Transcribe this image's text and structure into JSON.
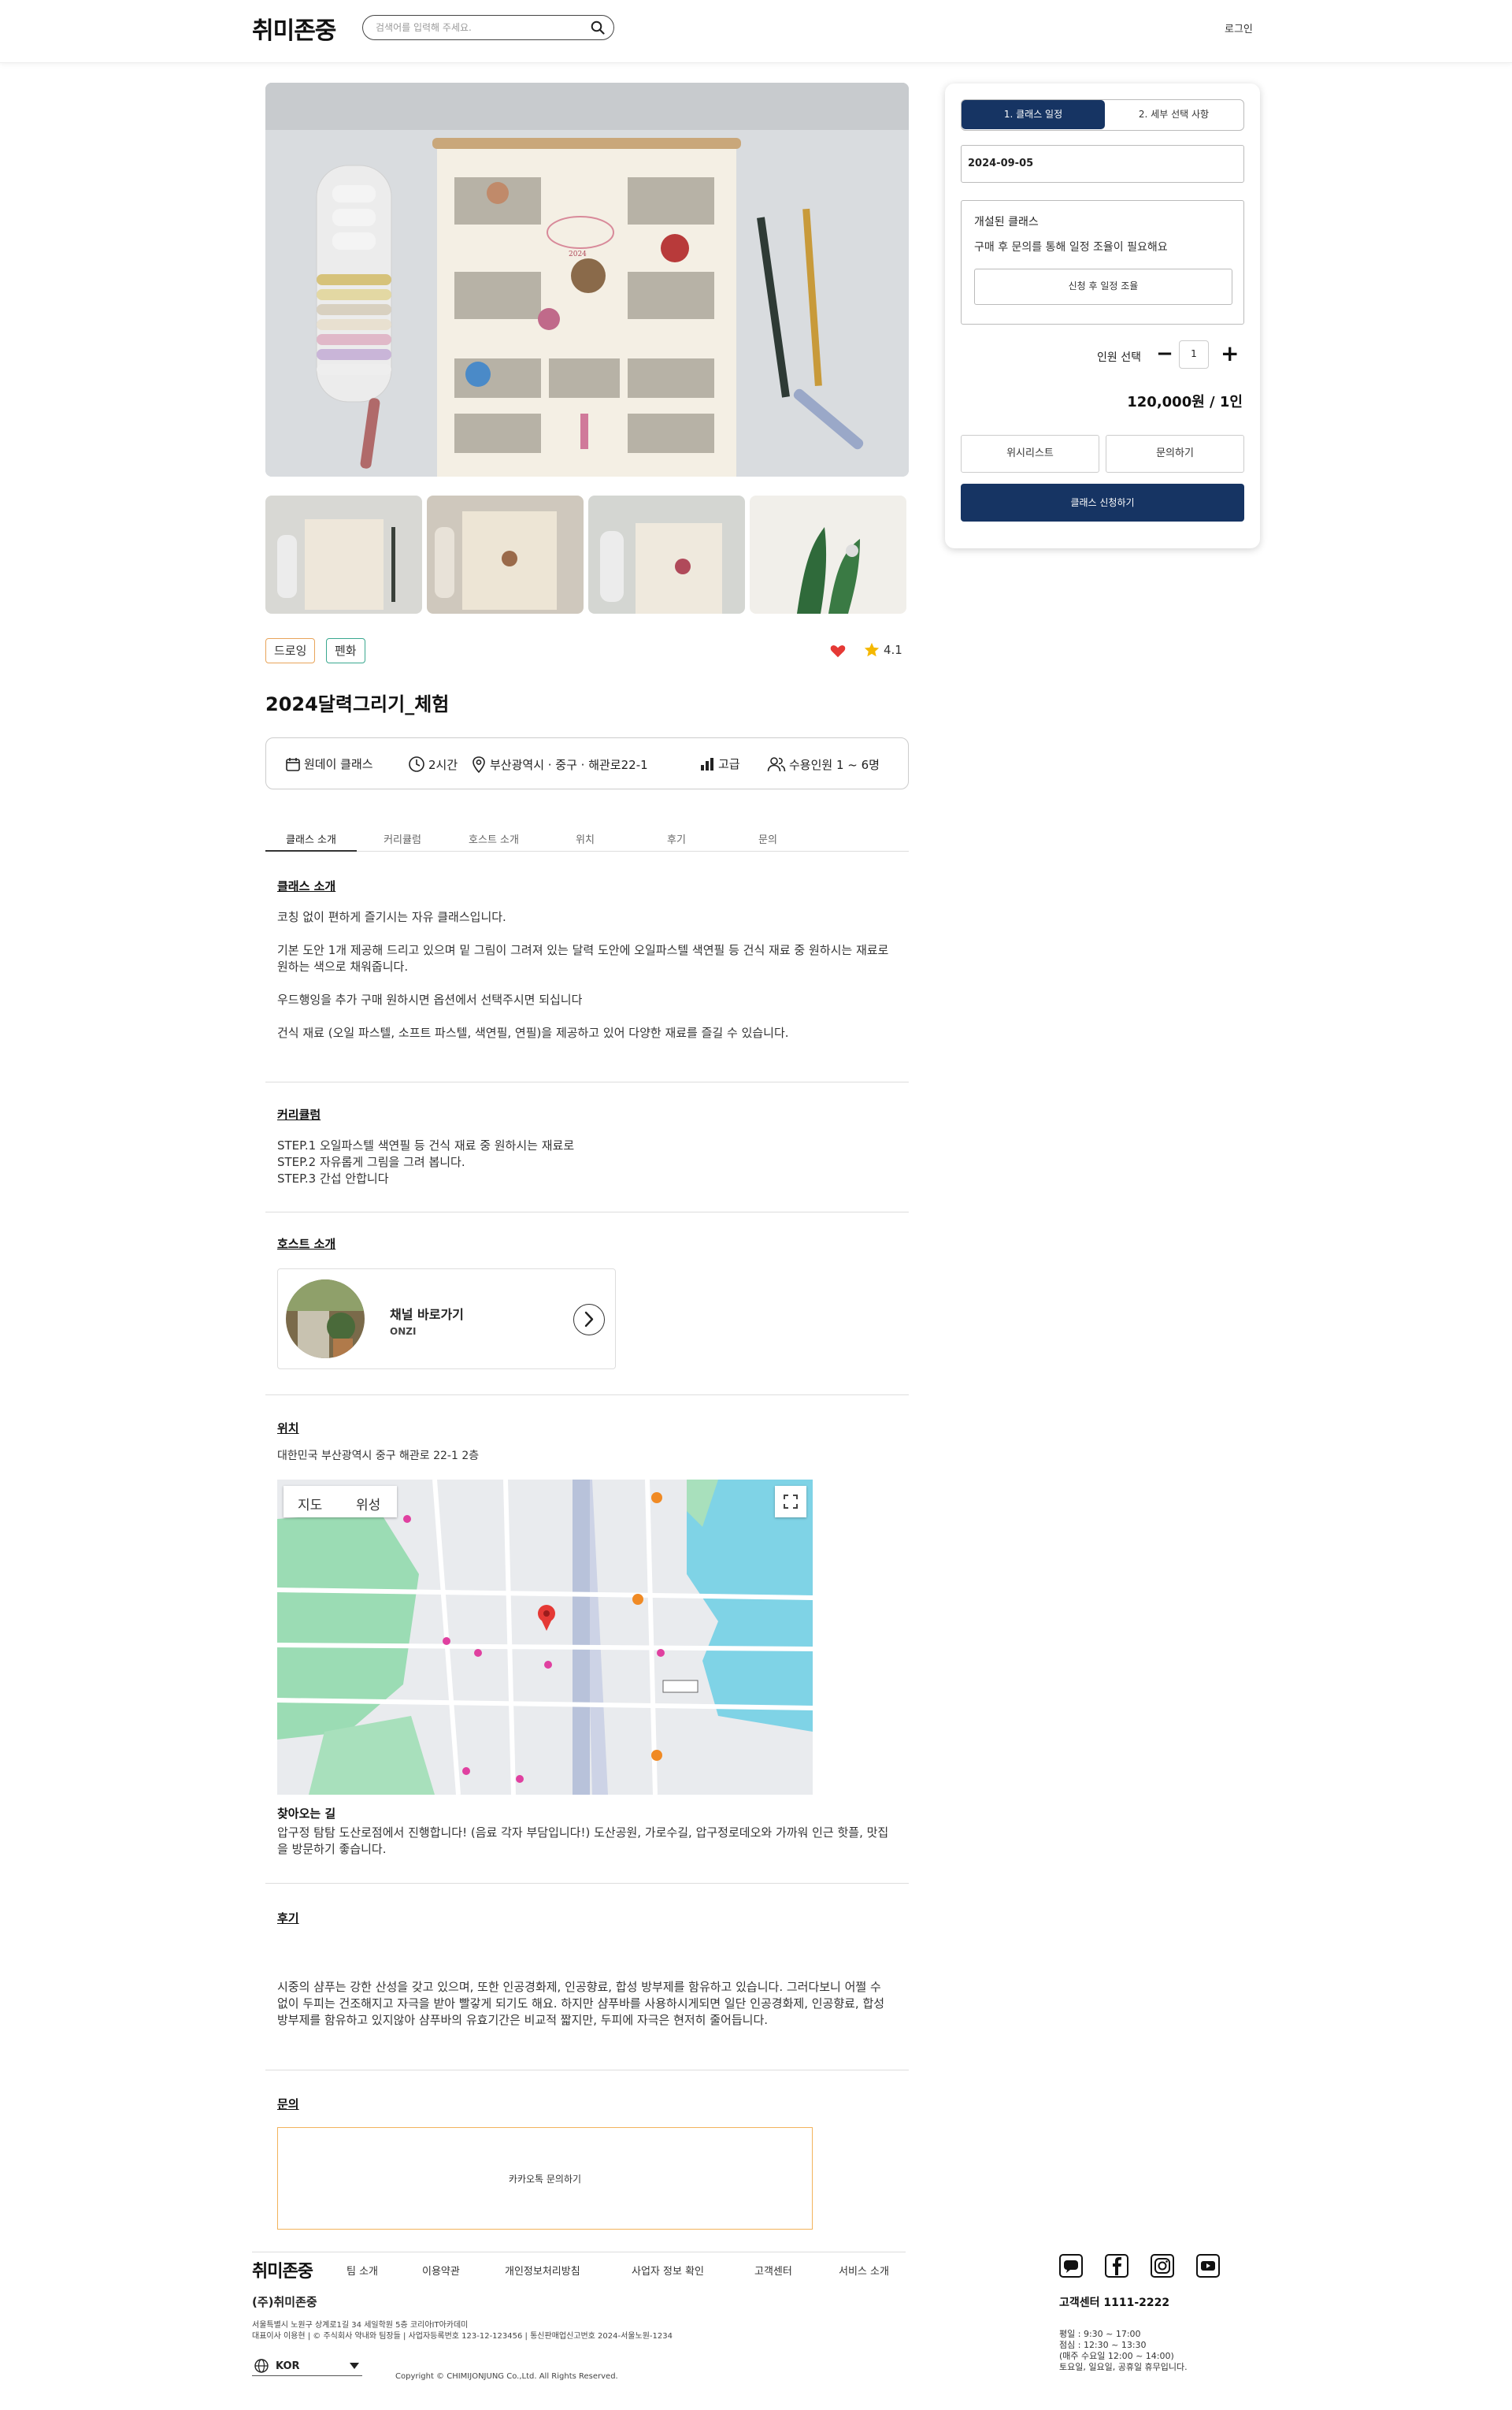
{
  "header": {
    "logo": "취미존중",
    "search_placeholder": "검색어를 입력해 주세요.",
    "login": "로그인"
  },
  "tags": [
    "드로잉",
    "펜화"
  ],
  "rating": "4.1",
  "title": "2024달력그리기_체험",
  "info": {
    "type": "원데이 클래스",
    "duration": "2시간",
    "location": "부산광역시 · 중구 · 해관로22-1",
    "level": "고급",
    "capacity": "수용인원 1 ~ 6명"
  },
  "tabs": [
    "클래스 소개",
    "커리큘럼",
    "호스트 소개",
    "위치",
    "후기",
    "문의"
  ],
  "intro": {
    "heading": "클래스 소개",
    "p1": "코칭 없이 편하게 즐기시는 자유 클래스입니다.",
    "p2": "기본 도안 1개 제공해 드리고 있으며 밑 그림이 그려져 있는 달력 도안에 오일파스텔 색연필 등 건식 재료 중 원하시는 재료로 원하는 색으로 채워줍니다.",
    "p3": "우드행잉을 추가 구매 원하시면 옵션에서 선택주시면 되십니다",
    "p4": "건식 재료 (오일 파스텔, 소프트 파스텔, 색연필, 연필)을 제공하고 있어 다양한 재료를 즐길 수 있습니다."
  },
  "curriculum": {
    "heading": "커리큘럼",
    "step1": "STEP.1 오일파스텔 색연필 등 건식 재료 중 원하시는 재료로",
    "step2": "STEP.2 자유롭게 그림을 그려 봅니다.",
    "step3": "STEP.3 간섭 안합니다"
  },
  "host": {
    "heading": "호스트 소개",
    "name": "채널 바로가기",
    "sub": "ONZI"
  },
  "location": {
    "heading": "위치",
    "address": "대한민국 부산광역시 중구 해관로 22-1 2층",
    "map_tab_map": "지도",
    "map_tab_satellite": "위성",
    "directions_title": "찾아오는 길",
    "directions": "압구정 탐탐 도산로점에서 진행합니다! (음료 각자 부담입니다!) 도산공원, 가로수길, 압구정로데오와 가까워 인근 핫플, 맛집을 방문하기 좋습니다."
  },
  "review": {
    "heading": "후기",
    "text": "시중의 샴푸는 강한 산성을 갖고 있으며, 또한 인공경화제, 인공향료, 합성 방부제를 함유하고 있습니다. 그러다보니 어쩔 수 없이 두피는 건조해지고 자극을 받아 빨갛게 되기도 해요. 하지만 샴푸바를 사용하시게되면 일단 인공경화제, 인공향료, 합성 방부제를 함유하고 있지않아 샴푸바의 유효기간은 비교적 짧지만, 두피에 자극은 현저히 줄어듭니다."
  },
  "inquiry": {
    "heading": "문의",
    "button": "카카오톡 문의하기"
  },
  "sidebar": {
    "step1": "1. 클래스 일정",
    "step2": "2. 세부 선택 사항",
    "date": "2024-09-05",
    "open_title": "개설된 클래스",
    "open_desc": "구매 후 문의를 통해 일정 조율이 필요해요",
    "open_button": "신청 후 일정 조율",
    "qty_label": "인원 선택",
    "qty_value": "1",
    "price": "120,000원 / 1인",
    "wishlist": "위시리스트",
    "inquiry": "문의하기",
    "apply": "클래스 신청하기"
  },
  "footer": {
    "logo": "취미존중",
    "links": [
      "팀 소개",
      "이용약관",
      "개인정보처리방침",
      "사업자 정보 확인",
      "고객센터",
      "서비스 소개"
    ],
    "company": "(주)취미존중",
    "addr1": "서울특별시 노원구 상계로1길 34 세일학원 5층 코리아IT아카데미",
    "addr2": "대표이사 이용현 | © 주식회사 약내와 팀장들 | 사업자등록번호 123-12-123456 | 통신판매업신고번호 2024-서울노원-1234",
    "lang": "KOR",
    "copyright": "Copyright © CHIMIJONJUNG Co.,Ltd. All Rights Reserved.",
    "cs_title": "고객센터 1111-2222",
    "cs_h1": "평일 : 9:30 ~ 17:00",
    "cs_h2": "점심 : 12:30 ~ 13:30",
    "cs_h3": "(매주 수요일 12:00 ~ 14:00)",
    "cs_h4": "토요일, 일요일, 공휴일 휴무입니다."
  }
}
